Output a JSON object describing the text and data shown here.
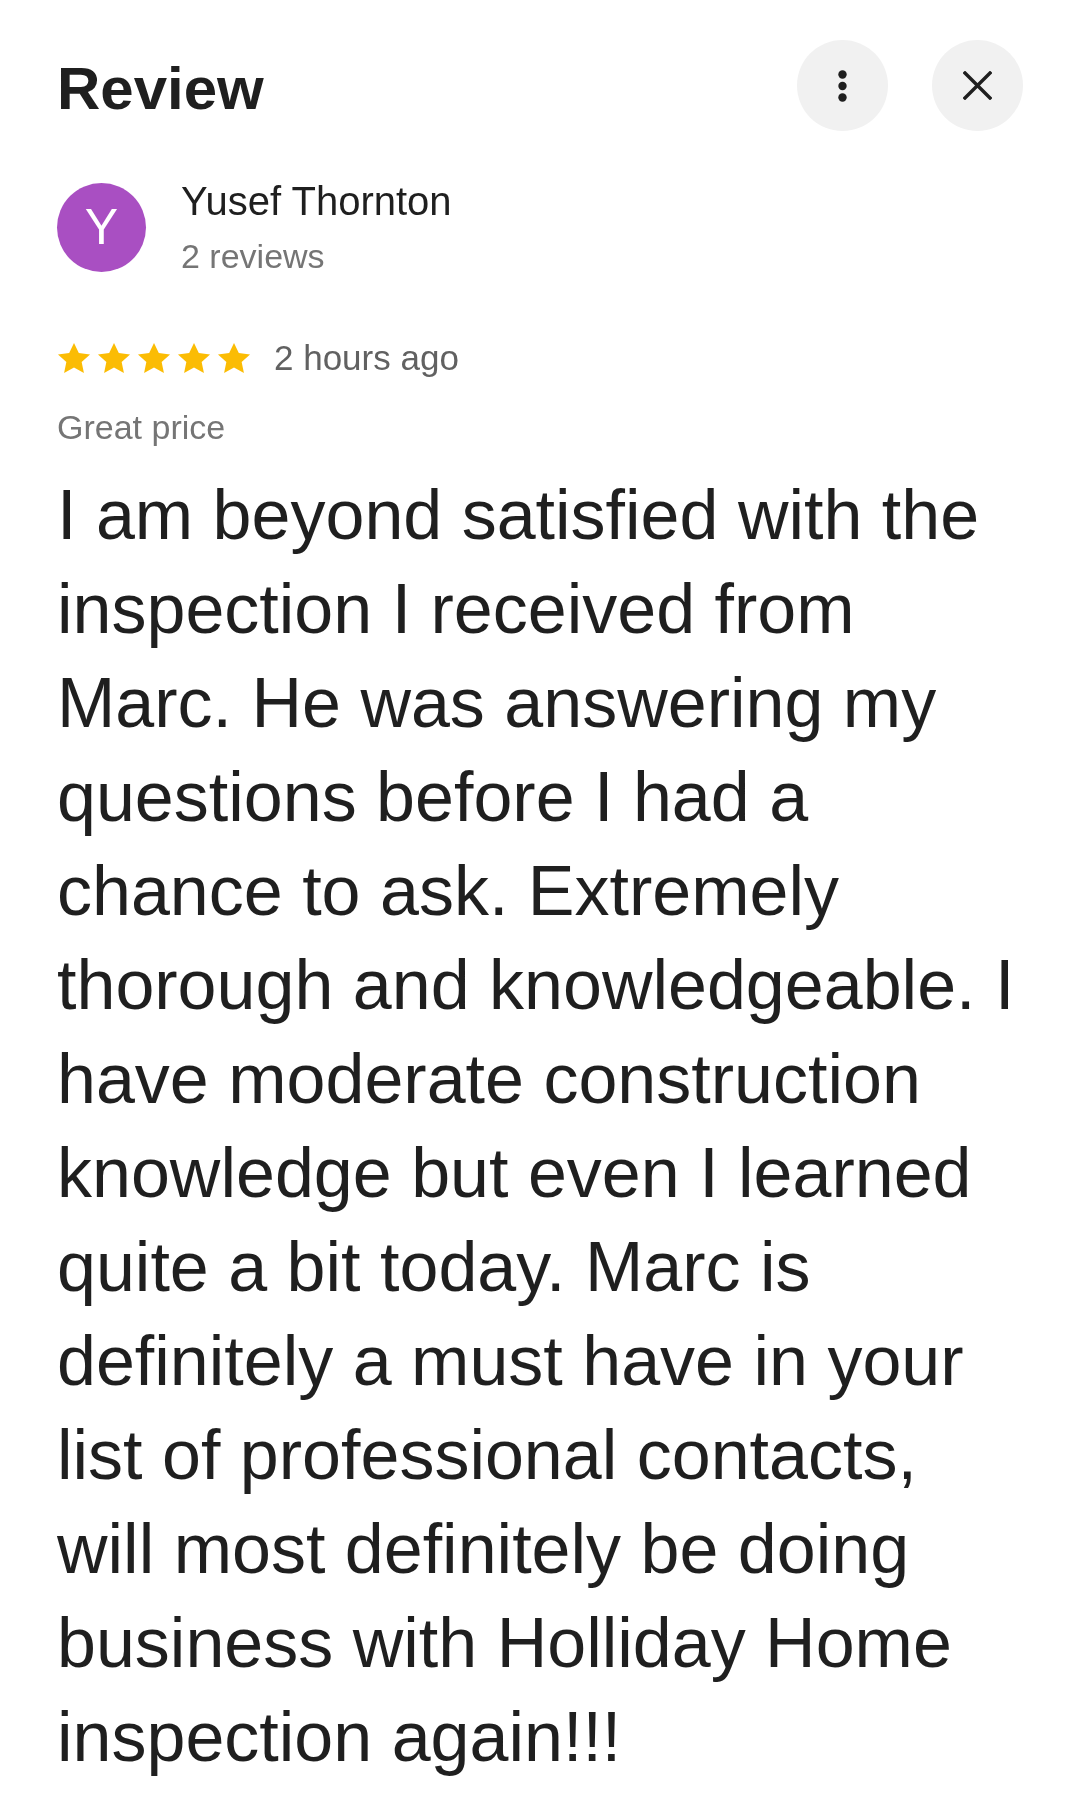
{
  "header": {
    "title": "Review",
    "buttons": [
      {
        "kind": "more"
      },
      {
        "kind": "close"
      }
    ]
  },
  "reviewer": {
    "initial": "Y",
    "name": "Yusef Thornton",
    "review_count": "2 reviews"
  },
  "rating": {
    "stars": 5,
    "time": "2 hours ago"
  },
  "tag": "Great price",
  "body": "I am beyond satisfied with the inspection I received from Marc. He was answering my questions before I had a chance to ask. Extremely thorough and knowledgeable. I have moderate construction knowledge but even I learned quite a bit today. Marc is definitely a must have in your list of professional contacts, will most definitely be doing business with Holliday Home inspection again!!!"
}
